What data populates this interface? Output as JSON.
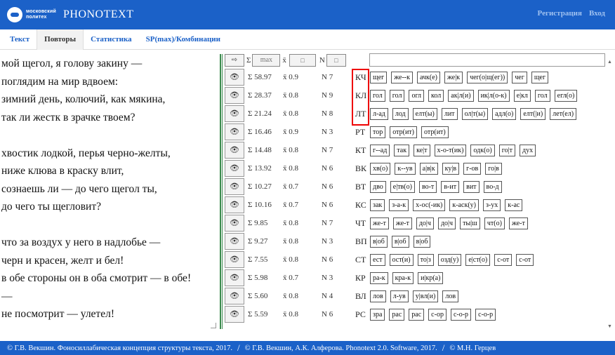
{
  "header": {
    "logo_line1": "московский",
    "logo_line2": "политех",
    "app_name": "PHONOTEXT",
    "register": "Регистрация",
    "login": "Вход"
  },
  "tabs": [
    {
      "label": "Текст"
    },
    {
      "label": "Повторы"
    },
    {
      "label": "Статистика"
    },
    {
      "label": "SP(max)/Комбинации"
    }
  ],
  "poem": [
    "мой щегол, я голову закину —",
    "поглядим на мир вдвоем:",
    "зимний день, колючий, как мякина,",
    "так ли жестк в зрачке твоем?",
    "",
    "хвостик лодкой, перья черно-желты,",
    "ниже клюва в краску влит,",
    "сознаешь ли — до чего щегол ты,",
    "до чего ты щегловит?",
    "",
    "что за воздух у него в надлобье —",
    "черн и красен, желт и бел!",
    "в обе стороны он в оба смотрит — в обе!",
    "—",
    "не посмотрит — улетел!"
  ],
  "controls": {
    "arrow": "⇨",
    "sigma": "Σ",
    "max": "max",
    "xbar": "x̄",
    "n": "N",
    "square": "□"
  },
  "rows": [
    {
      "eye": "👁",
      "sum": "Σ 58.97",
      "avg": "x̄ 0.9",
      "n": "N 7",
      "code": "КЧ",
      "chips": [
        "щег",
        "же--к",
        "ачк(е)",
        "же|к",
        "чег(о|щ(ег))",
        "чег",
        "щег"
      ]
    },
    {
      "eye": "👁",
      "sum": "Σ 28.37",
      "avg": "x̄ 0.8",
      "n": "N 9",
      "code": "КЛ",
      "chips": [
        "гол",
        "гол",
        "огл",
        "кол",
        "ак|л(и)",
        "ик|л(о-к)",
        "е|кл",
        "гол",
        "егл(о)"
      ]
    },
    {
      "eye": "👁",
      "sum": "Σ 21.24",
      "avg": "x̄ 0.8",
      "n": "N 8",
      "code": "ЛТ",
      "chips": [
        "л-ад",
        "лод",
        "елт(ы)",
        "лит",
        "ол|т(ы)",
        "адл(о)",
        "елт(|и)",
        "лет(ел)"
      ]
    },
    {
      "eye": "👁",
      "sum": "Σ 16.46",
      "avg": "x̄ 0.9",
      "n": "N 3",
      "code": "РТ",
      "chips": [
        "тор",
        "отр(ит)",
        "отр(ит)"
      ]
    },
    {
      "eye": "👁",
      "sum": "Σ 14.48",
      "avg": "x̄ 0.8",
      "n": "N 7",
      "code": "КТ",
      "chips": [
        "г--ад",
        "так",
        "ке|т",
        "х-о-т(ик)",
        "одк(о)",
        "го|т",
        "дух"
      ]
    },
    {
      "eye": "👁",
      "sum": "Σ 13.92",
      "avg": "x̄ 0.8",
      "n": "N 6",
      "code": "ВК",
      "chips": [
        "хв(о)",
        "к--ув",
        "а|в|к",
        "ку|в",
        "г-ов",
        "го|в"
      ]
    },
    {
      "eye": "👁",
      "sum": "Σ 10.27",
      "avg": "x̄ 0.7",
      "n": "N 6",
      "code": "ВТ",
      "chips": [
        "дво",
        "е|тв(о)",
        "во-т",
        "в-ит",
        "вит",
        "во-д"
      ]
    },
    {
      "eye": "👁",
      "sum": "Σ 10.16",
      "avg": "x̄ 0.7",
      "n": "N 6",
      "code": "КС",
      "chips": [
        "зак",
        "з-а-к",
        "х-ос(-ик)",
        "к-аск(у)",
        "з-ух",
        "к-ас"
      ]
    },
    {
      "eye": "👁",
      "sum": "Σ 9.85",
      "avg": "x̄ 0.8",
      "n": "N 7",
      "code": "ЧТ",
      "chips": [
        "же-т",
        "же-т",
        "до|ч",
        "до|ч",
        "ты|ш",
        "чт(о)",
        "же-т"
      ]
    },
    {
      "eye": "👁",
      "sum": "Σ 9.27",
      "avg": "x̄ 0.8",
      "n": "N 3",
      "code": "ВП",
      "chips": [
        "в|об",
        "в|об",
        "в|об"
      ]
    },
    {
      "eye": "👁",
      "sum": "Σ 7.55",
      "avg": "x̄ 0.8",
      "n": "N 6",
      "code": "СТ",
      "chips": [
        "ест",
        "ост(и)",
        "то|з",
        "озд(у)",
        "е|ст(о)",
        "с-от",
        "с-от"
      ]
    },
    {
      "eye": "👁",
      "sum": "Σ 5.98",
      "avg": "x̄ 0.7",
      "n": "N 3",
      "code": "КР",
      "chips": [
        "ра-к",
        "кра-к",
        "и|кр(а)"
      ]
    },
    {
      "eye": "👁",
      "sum": "Σ 5.60",
      "avg": "x̄ 0.8",
      "n": "N 4",
      "code": "ВЛ",
      "chips": [
        "лов",
        "л-ув",
        "у|вл(и)",
        "лов"
      ]
    },
    {
      "eye": "👁",
      "sum": "Σ 5.59",
      "avg": "x̄ 0.8",
      "n": "N 6",
      "code": "РС",
      "chips": [
        "зра",
        "рас",
        "рас",
        "с-ор",
        "с-о-р",
        "с-о-р"
      ]
    }
  ],
  "footer": {
    "part1": "© Г.В. Векшин. Фоносиллабическая концепция структуры текста, 2017.",
    "part2": "© Г.В. Векшин, А.К. Алферова. Phonotext 2.0. Software, 2017.",
    "part3": "© М.Н. Герцев",
    "sep": "/"
  },
  "colors": {
    "header_bg": "#1b61c8",
    "highlight": "#e00000",
    "divider": "#3b8a4d"
  }
}
